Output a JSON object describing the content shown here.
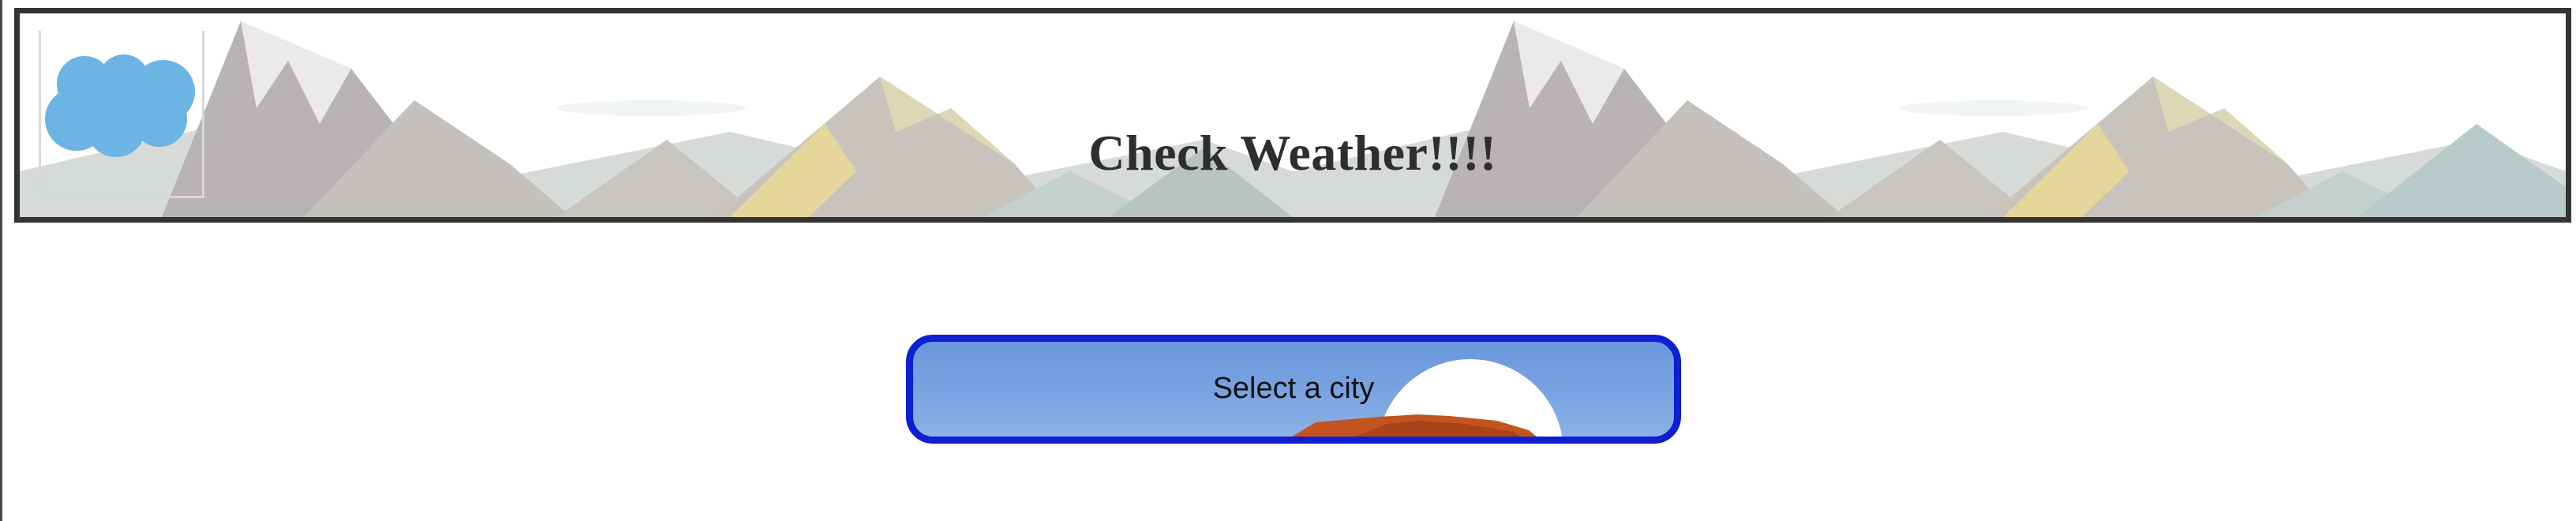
{
  "header": {
    "title": "Check Weather!!!!",
    "logo_icon": "cloud-logo-icon",
    "logo_color": "#6bb4e4",
    "background_icon": "mountain-range-illustration"
  },
  "selector": {
    "label": "Select a city",
    "border_color": "#0d1fd0",
    "fill_color": "#7aa4e2",
    "decoration_icon": "sunset-icon"
  }
}
